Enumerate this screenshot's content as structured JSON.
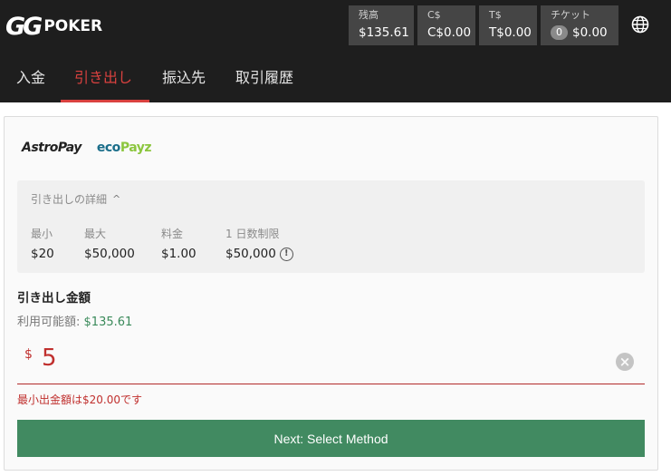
{
  "header": {
    "logo": {
      "gg": "GG",
      "poker": "POKER"
    },
    "balances": [
      {
        "label": "残高",
        "value": "$135.61"
      },
      {
        "label": "C$",
        "value": "C$0.00"
      },
      {
        "label": "T$",
        "value": "T$0.00"
      },
      {
        "label": "チケット",
        "count": "0",
        "value": "$0.00"
      }
    ],
    "globe_icon": "globe-icon"
  },
  "tabs": [
    {
      "label": "入金"
    },
    {
      "label": "引き出し",
      "active": true
    },
    {
      "label": "振込先"
    },
    {
      "label": "取引履歴"
    }
  ],
  "payment_logos": {
    "astropay": "AstroPay",
    "eco": "eco",
    "payz": "Payz"
  },
  "details": {
    "title": "引き出しの詳細",
    "min_label": "最小",
    "min_value": "$20",
    "max_label": "最大",
    "max_value": "$50,000",
    "fee_label": "料金",
    "fee_value": "$1.00",
    "daily_label": "1 日数制限",
    "daily_value": "$50,000"
  },
  "amount": {
    "title": "引き出し金額",
    "available_label": "利用可能額:",
    "available_value": "$135.61",
    "currency": "$",
    "value": "5",
    "error": "最小出金額は$20.00です"
  },
  "next_button": "Next: Select Method",
  "colors": {
    "accent_red": "#d9413f",
    "green": "#418a61",
    "topbar": "#1e1e1e"
  }
}
